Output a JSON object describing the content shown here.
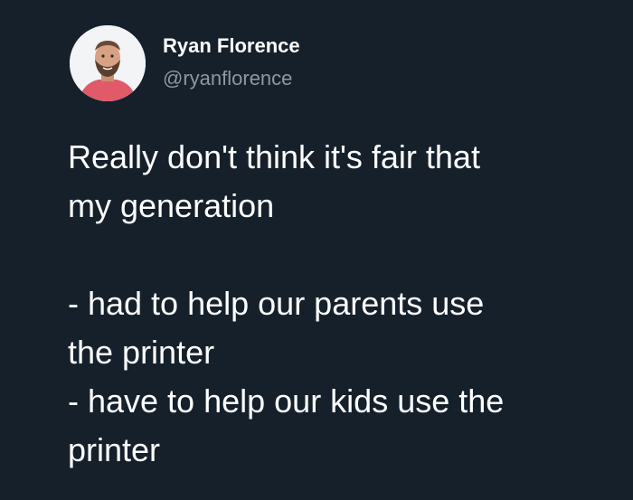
{
  "author": {
    "display_name": "Ryan Florence",
    "handle": "@ryanflorence"
  },
  "tweet": {
    "lines": [
      "Really don't think it's fair that",
      "my generation",
      "",
      "- had to help our parents use",
      "the printer",
      "- have to help our kids use the",
      "printer"
    ]
  },
  "colors": {
    "background": "#15202b",
    "text_primary": "#ffffff",
    "text_secondary": "#8b98a5"
  }
}
